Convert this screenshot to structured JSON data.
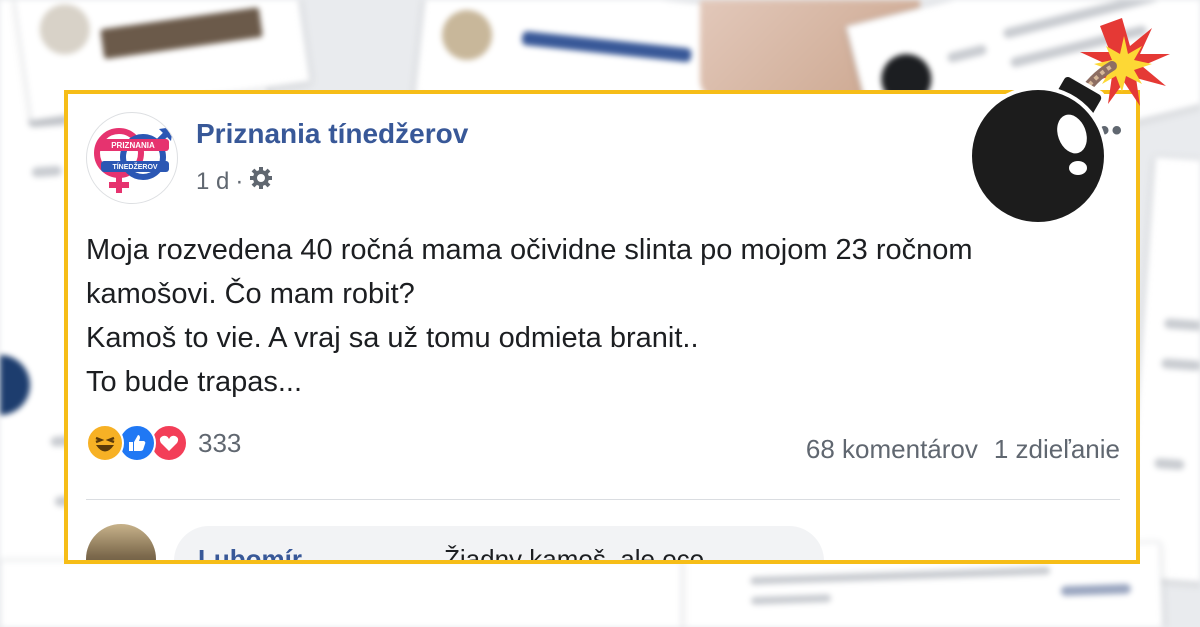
{
  "post": {
    "page_name": "Priznania tínedžerov",
    "time": "1 d",
    "separator": "·",
    "avatar_logo_text_top": "PRIZNANIA",
    "avatar_logo_text_bottom": "TÍNEDŽEROV",
    "text_lines": [
      "Moja rozvedena 40 ročná mama očividne slinta po mojom 23 ročnom",
      "kamošovi. Čo mam robit?",
      "Kamoš to vie. A vraj sa už tomu odmieta branit..",
      "To bude trapas..."
    ],
    "reaction_count": "333",
    "comments_count": "68 komentárov",
    "shares_count": "1 zdieľanie",
    "reactions": [
      "haha-icon",
      "like-icon",
      "love-icon"
    ]
  },
  "comment": {
    "author": "Lubomír",
    "text": "Žiadny kamoš, ale oco"
  },
  "colors": {
    "frame": "#f6bd17",
    "link_blue": "#385898",
    "meta_gray": "#606770",
    "like_blue": "#2078f4",
    "love_red": "#f33e58",
    "haha_yellow": "#f7b125"
  }
}
